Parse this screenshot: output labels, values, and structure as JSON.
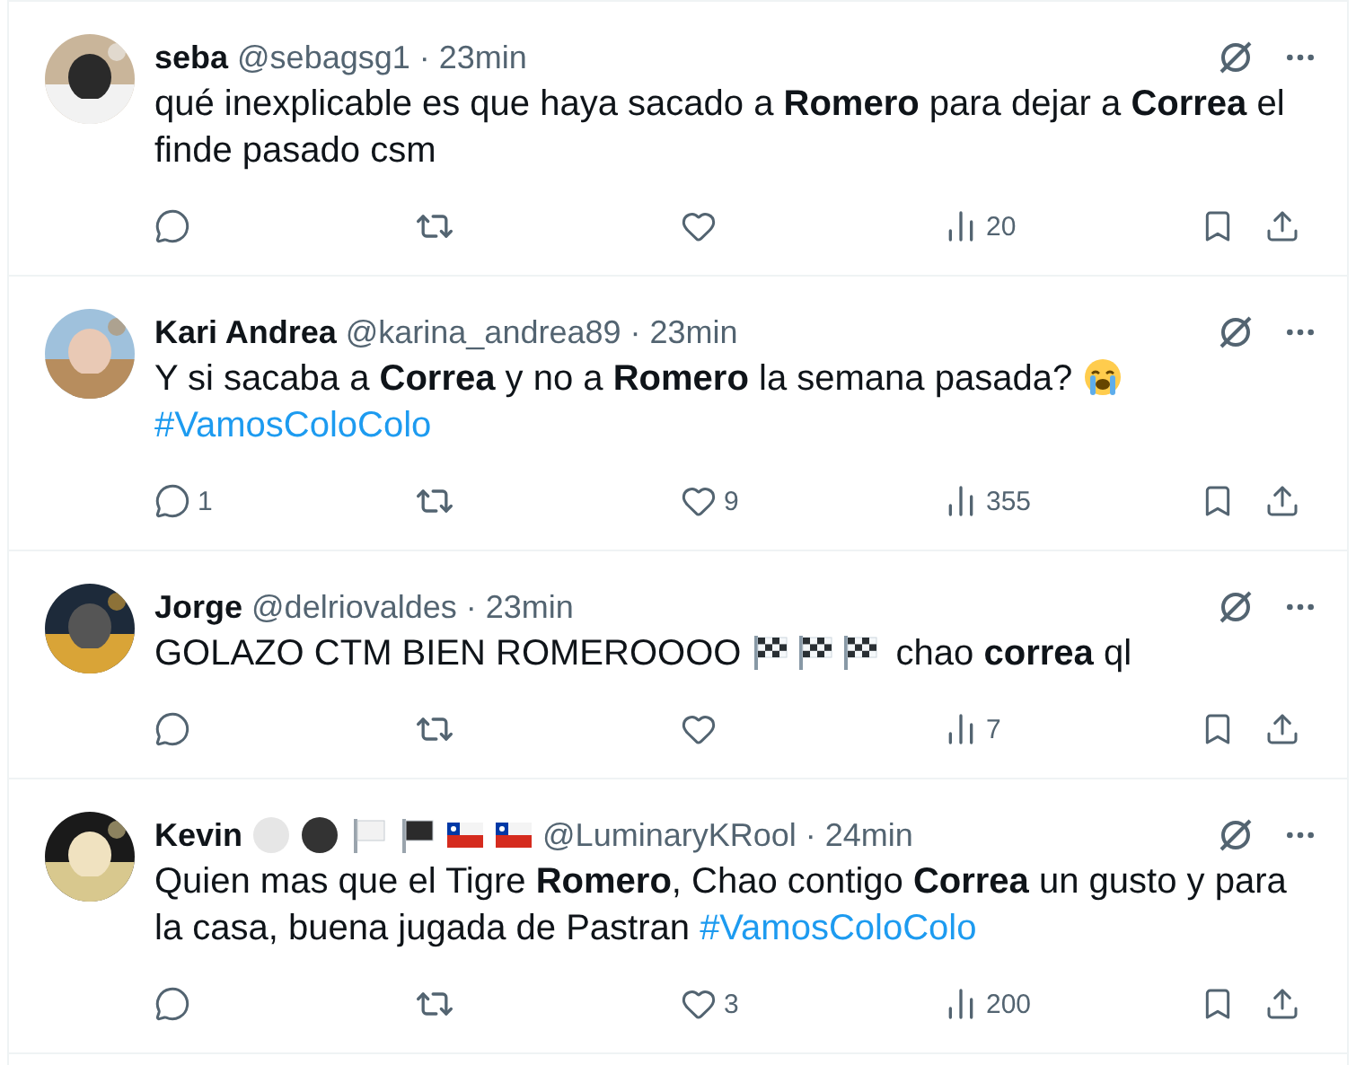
{
  "tweets": [
    {
      "name": "seba",
      "handle": "@sebagsg1",
      "separator": "·",
      "time": "23min",
      "avatar": {
        "kind": "picture"
      },
      "body": [
        {
          "kind": "text",
          "text": "qué inexplicable es que haya sacado a **Romero** para dejar a **Correa** el finde pasado csm"
        }
      ],
      "views": "20"
    },
    {
      "name": "Kari Andrea",
      "handle": "@karina_andrea89",
      "separator": "·",
      "time": "23min",
      "avatar": {
        "kind": "picture"
      },
      "body": [
        {
          "kind": "text",
          "text": "Y si sacaba a **Correa** y no a **Romero** la semana pasada? "
        },
        {
          "kind": "crying-emoji"
        },
        {
          "kind": "break"
        },
        {
          "kind": "hashtag",
          "text": "#VamosColoColo"
        }
      ],
      "replies": "1",
      "likes": "9",
      "views": "355"
    },
    {
      "name": "Jorge",
      "handle": "@delriovaldes",
      "separator": "·",
      "time": "23min",
      "avatar": {
        "kind": "picture"
      },
      "body": [
        {
          "kind": "text",
          "text": "GOLAZO CTM BIEN ROMEROOOO "
        },
        {
          "kind": "flag-emoji"
        },
        {
          "kind": "flag-emoji"
        },
        {
          "kind": "flag-emoji"
        },
        {
          "kind": "text",
          "text": " chao **correa** ql"
        }
      ],
      "views": "7"
    },
    {
      "name": "Kevin",
      "name_badges": [
        {
          "kind": "circle",
          "color": "#e6e6e6"
        },
        {
          "kind": "circle",
          "color": "#333333"
        },
        {
          "kind": "flag",
          "color": "#f2f2f2"
        },
        {
          "kind": "flag",
          "color": "#2b2b2b"
        },
        {
          "kind": "chile-flag"
        },
        {
          "kind": "chile-flag"
        }
      ],
      "handle": "@LuminaryKRool",
      "separator": "·",
      "time": "24min",
      "avatar": {
        "kind": "picture"
      },
      "body": [
        {
          "kind": "text",
          "text": "Quien mas que el Tigre **Romero**, Chao contigo **Correa** un gusto y para la casa, buena jugada de Pastran "
        },
        {
          "kind": "hashtag",
          "text": "#VamosColoColo"
        }
      ],
      "likes": "3",
      "views": "200"
    }
  ]
}
